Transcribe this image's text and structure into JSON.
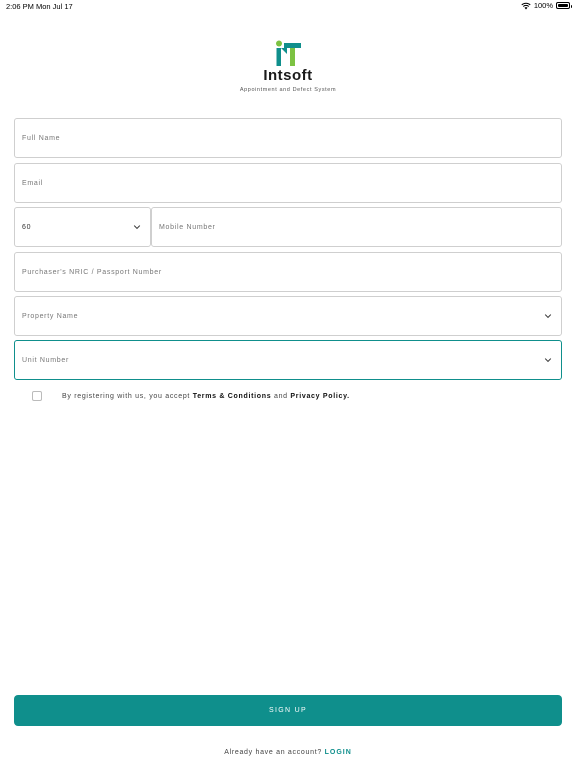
{
  "status_bar": {
    "time": "2:06 PM",
    "date": "Mon Jul 17",
    "battery": "100%"
  },
  "logo": {
    "name": "Intsoft",
    "tagline": "Appointment and Defect System"
  },
  "form": {
    "full_name_placeholder": "Full Name",
    "email_placeholder": "Email",
    "country_code": "60",
    "mobile_placeholder": "Mobile Number",
    "nric_placeholder": "Purchaser's NRIC / Passport Number",
    "property_placeholder": "Property Name",
    "unit_placeholder": "Unit Number"
  },
  "terms": {
    "prefix": "By registering with us, you accept",
    "terms_link": "Terms & Conditions",
    "conjunction": "and",
    "privacy_link": "Privacy Policy."
  },
  "signup_label": "SIGN UP",
  "footer": {
    "question": "Already have an account?",
    "login_label": "LOGIN"
  },
  "colors": {
    "accent": "#0f8f8c",
    "logo_green": "#7cc242"
  }
}
